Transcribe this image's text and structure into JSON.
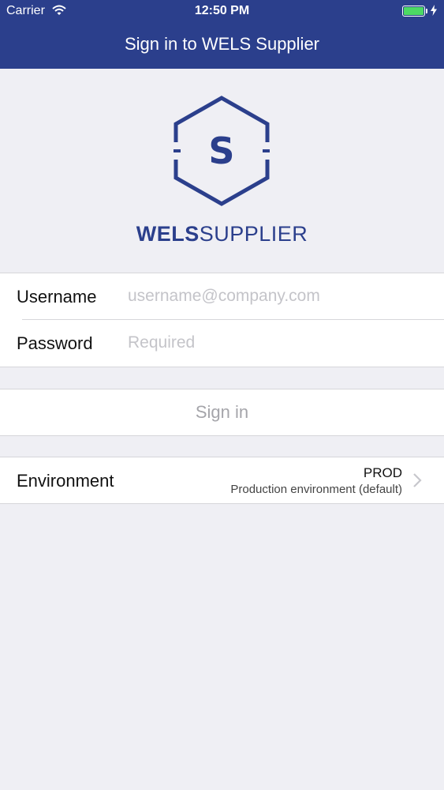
{
  "status_bar": {
    "carrier": "Carrier",
    "time": "12:50 PM",
    "battery_level": 1.0,
    "battery_color": "#4cd964"
  },
  "nav": {
    "title": "Sign in to WELS Supplier"
  },
  "logo": {
    "mark_letter": "S",
    "brand_bold": "WELS",
    "brand_light": "SUPPLIER",
    "color": "#2b3f8c"
  },
  "form": {
    "username": {
      "label": "Username",
      "placeholder": "username@company.com",
      "value": ""
    },
    "password": {
      "label": "Password",
      "placeholder": "Required",
      "value": ""
    }
  },
  "signin": {
    "label": "Sign in"
  },
  "environment": {
    "label": "Environment",
    "code": "PROD",
    "description": "Production environment (default)"
  },
  "colors": {
    "nav_background": "#2b3f8c",
    "page_background": "#efeff4",
    "disabled_text": "#a5a5aa",
    "placeholder_text": "#c4c4c9"
  }
}
